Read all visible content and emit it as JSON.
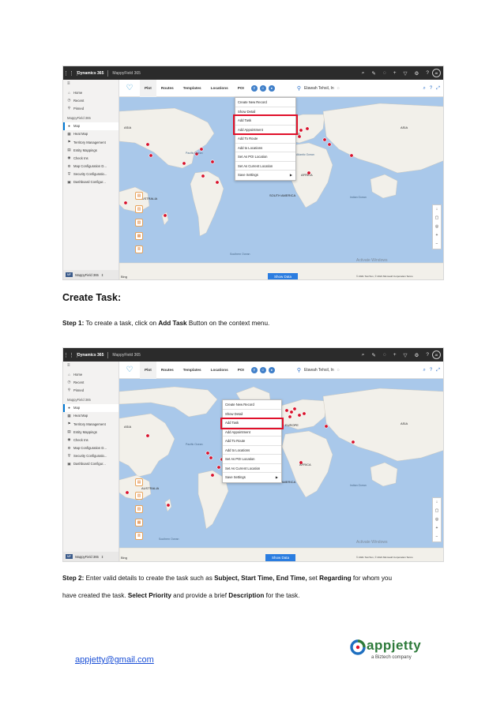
{
  "dynamics_ui": {
    "brand": "Dynamics 365",
    "app_name": "MappyField 365",
    "avatar": "AI",
    "sidebar": {
      "top_items": [
        {
          "label": "Home",
          "icon": "home-icon"
        },
        {
          "label": "Recent",
          "icon": "clock-icon"
        },
        {
          "label": "Pinned",
          "icon": "pin-icon"
        }
      ],
      "group_label": "MappyField 365",
      "items": [
        {
          "label": "Map",
          "icon": "map-pin-icon"
        },
        {
          "label": "Heat Map",
          "icon": "heatmap-icon"
        },
        {
          "label": "Territory Management",
          "icon": "territory-icon"
        },
        {
          "label": "Entity Mappings",
          "icon": "entity-icon"
        },
        {
          "label": "Check Ins",
          "icon": "checkin-icon"
        },
        {
          "label": "Map Configuration D...",
          "icon": "config-icon"
        },
        {
          "label": "Security Configuratio...",
          "icon": "security-icon"
        },
        {
          "label": "Dashboard Configur...",
          "icon": "dashboard-icon"
        }
      ],
      "footer_badge": "MF",
      "footer_label": "MappyField 365"
    },
    "map_tabs": [
      "Plot",
      "Routes",
      "Templates",
      "Locations",
      "POI"
    ],
    "location": "Etawah Tehsil, In",
    "context_menu": [
      {
        "label": "Create New Record",
        "submenu": false
      },
      {
        "label": "Show Detail",
        "submenu": false
      },
      {
        "label": "Add Task",
        "submenu": false
      },
      {
        "label": "Add Appointment",
        "submenu": false
      },
      {
        "label": "Add To Route",
        "submenu": false
      },
      {
        "label": "Add to Locations",
        "submenu": false
      },
      {
        "label": "Set As POI Location",
        "submenu": false
      },
      {
        "label": "Set As Current Location",
        "submenu": false
      },
      {
        "label": "Save Settings",
        "submenu": true
      }
    ],
    "map_labels": {
      "asia_left": "ASIA",
      "asia_right": "ASIA",
      "europe": "EUROPE",
      "africa": "AFRICA",
      "australia": "AUSTRALIA",
      "south_america": "SOUTH AMERICA",
      "pacific": "Pacific Ocean",
      "atlantic": "Atlantic Ocean",
      "indian": "Indian Ocean",
      "southern": "Southern Ocean"
    },
    "show_data": "Show Data",
    "bing": "Bing",
    "watermark": "Activate Windows",
    "copyright": "© 2021 TomTom, © 2021 Microsoft Corporation Terms"
  },
  "document": {
    "heading": "Create Task:",
    "step1_label": "Step 1:",
    "step1_text_a": " To create a task, click on ",
    "step1_bold": "Add Task",
    "step1_text_b": " Button on the context menu.",
    "step2_label": "Step 2:",
    "step2_text_a": " Enter valid details to create the task such as ",
    "step2_subject": "Subject, Start Time, End Time,",
    "step2_text_b": " set ",
    "step2_regarding": "Regarding",
    "step2_text_c": " for whom you",
    "step2_line2_a": "have created the task. ",
    "step2_priority": "Select Priority",
    "step2_line2_b": " and provide a brief ",
    "step2_description": "Description",
    "step2_line2_c": " for the task.",
    "email": "appjetty@gmail.com",
    "logo_word": "appjetty",
    "logo_tagline": "a Biztech company"
  },
  "colors": {
    "highlight": "#e0102a",
    "ocean": "#a9c8ea",
    "land": "#f2f0ea",
    "marker": "#d8102a",
    "link": "#1a4fd6",
    "logo_green": "#2d7a3a",
    "logo_blue": "#1e6fc0"
  }
}
